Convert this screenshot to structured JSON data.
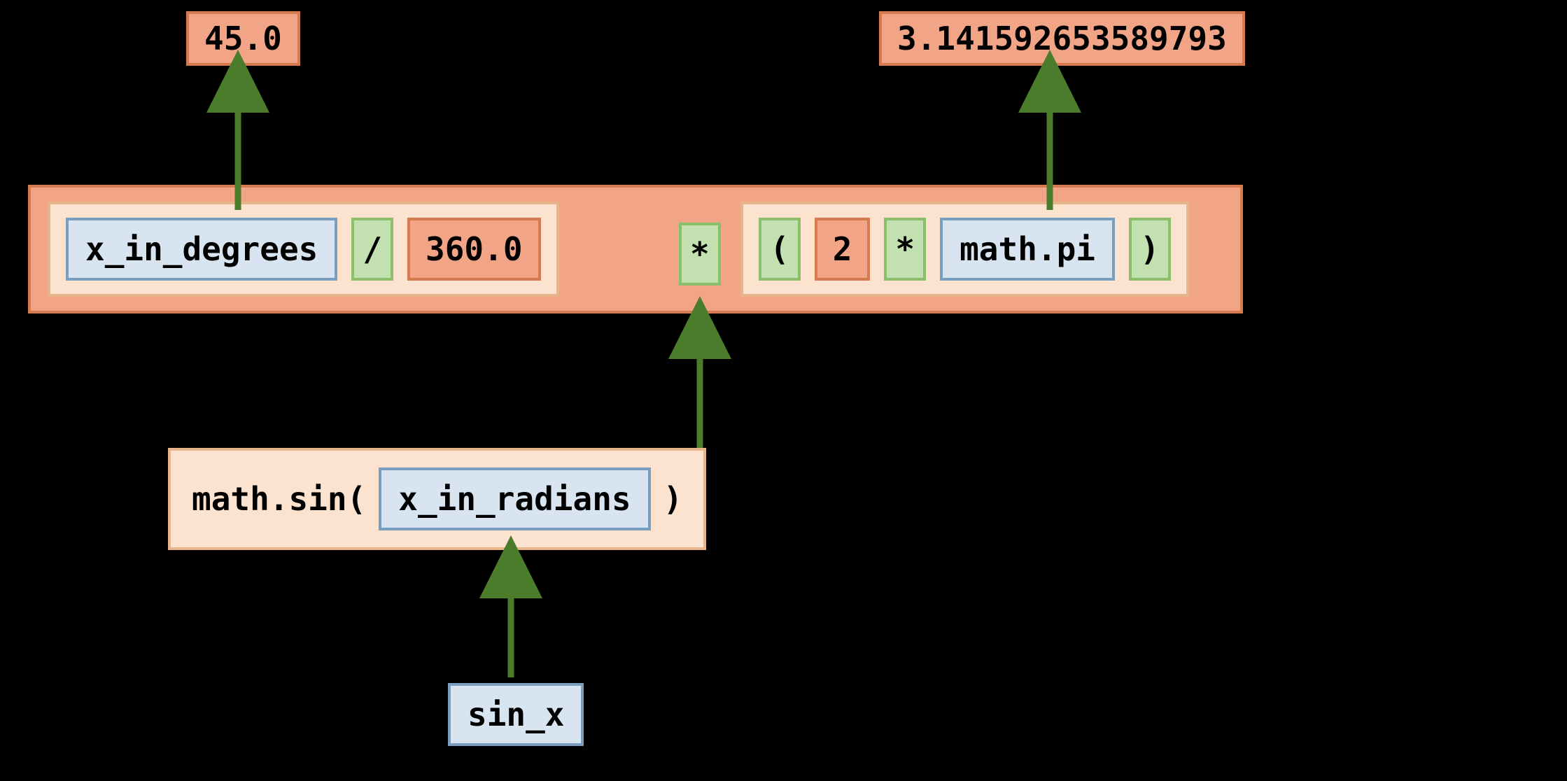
{
  "values": {
    "degrees_value": "45.0",
    "pi_value": "3.141592653589793"
  },
  "expr": {
    "var_degrees": "x_in_degrees",
    "op_div": "/",
    "lit_360": "360.0",
    "op_mul1": "*",
    "paren_open": "(",
    "lit_2": "2",
    "op_mul2": "*",
    "var_pi": "math.pi",
    "paren_close": ")"
  },
  "call": {
    "prefix": "math.sin(",
    "arg_var": "x_in_radians",
    "suffix": ")"
  },
  "result_var": "sin_x",
  "colors": {
    "value_bg": "#f2a586",
    "value_border": "#d67a50",
    "variable_bg": "#d8e4f0",
    "variable_border": "#7a9ec0",
    "operator_bg": "#c3e0b0",
    "operator_border": "#8bbf6a",
    "group_bg": "#fce3cf",
    "group_border": "#e8b48a",
    "arrow": "#4a7c2c"
  }
}
